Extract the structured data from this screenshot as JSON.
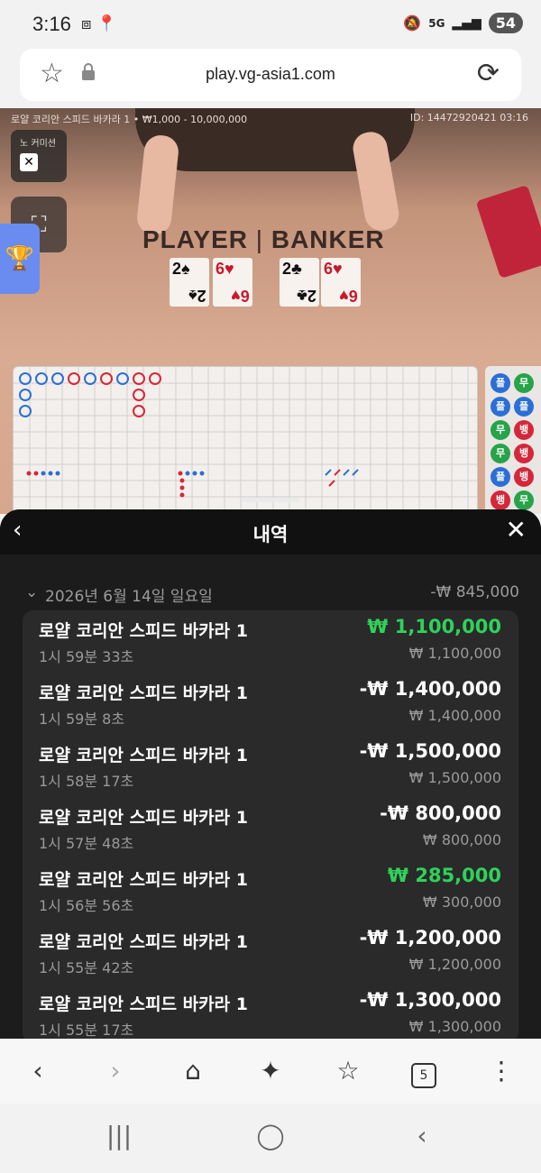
{
  "status": {
    "time": "3:16",
    "network": "5G",
    "battery": "54"
  },
  "browser": {
    "url": "play.vg-asia1.com",
    "tab_count": "5"
  },
  "game": {
    "table_info": "로얄 코리안 스피드 바카라 1 • ₩1,000 - 10,000,000",
    "round_id": "ID: 14472920421 03:16",
    "no_commission_label": "노 커미션",
    "player_label": "PLAYER",
    "banker_label": "BANKER",
    "player_cards": [
      {
        "rank": "2",
        "suit": "♠"
      },
      {
        "rank": "6",
        "suit": "♥"
      }
    ],
    "banker_cards": [
      {
        "rank": "2",
        "suit": "♣"
      },
      {
        "rank": "6",
        "suit": "♥"
      }
    ],
    "side_chips": [
      "플",
      "무",
      "플",
      "플",
      "무",
      "뱅",
      "무",
      "뱅",
      "플",
      "뱅",
      "뱅",
      "무"
    ]
  },
  "history": {
    "title": "내역",
    "date": "2026년 6월 14일 일요일",
    "date_total": "-₩ 845,000",
    "rows": [
      {
        "name": "로얄 코리안 스피드 바카라 1",
        "time": "1시 59분 33초",
        "amount": "₩ 1,100,000",
        "bet": "₩ 1,100,000",
        "win": true
      },
      {
        "name": "로얄 코리안 스피드 바카라 1",
        "time": "1시 59분 8초",
        "amount": "-₩ 1,400,000",
        "bet": "₩ 1,400,000",
        "win": false
      },
      {
        "name": "로얄 코리안 스피드 바카라 1",
        "time": "1시 58분 17초",
        "amount": "-₩ 1,500,000",
        "bet": "₩ 1,500,000",
        "win": false
      },
      {
        "name": "로얄 코리안 스피드 바카라 1",
        "time": "1시 57분 48초",
        "amount": "-₩ 800,000",
        "bet": "₩ 800,000",
        "win": false
      },
      {
        "name": "로얄 코리안 스피드 바카라 1",
        "time": "1시 56분 56초",
        "amount": "₩ 285,000",
        "bet": "₩ 300,000",
        "win": true
      },
      {
        "name": "로얄 코리안 스피드 바카라 1",
        "time": "1시 55분 42초",
        "amount": "-₩ 1,200,000",
        "bet": "₩ 1,200,000",
        "win": false
      },
      {
        "name": "로얄 코리안 스피드 바카라 1",
        "time": "1시 55분 17초",
        "amount": "-₩ 1,300,000",
        "bet": "₩ 1,300,000",
        "win": false
      }
    ]
  },
  "colors": {
    "win": "#2fd25a",
    "player_blue": "#2b6fd6",
    "banker_red": "#d4283a",
    "tie_green": "#27a34a"
  }
}
